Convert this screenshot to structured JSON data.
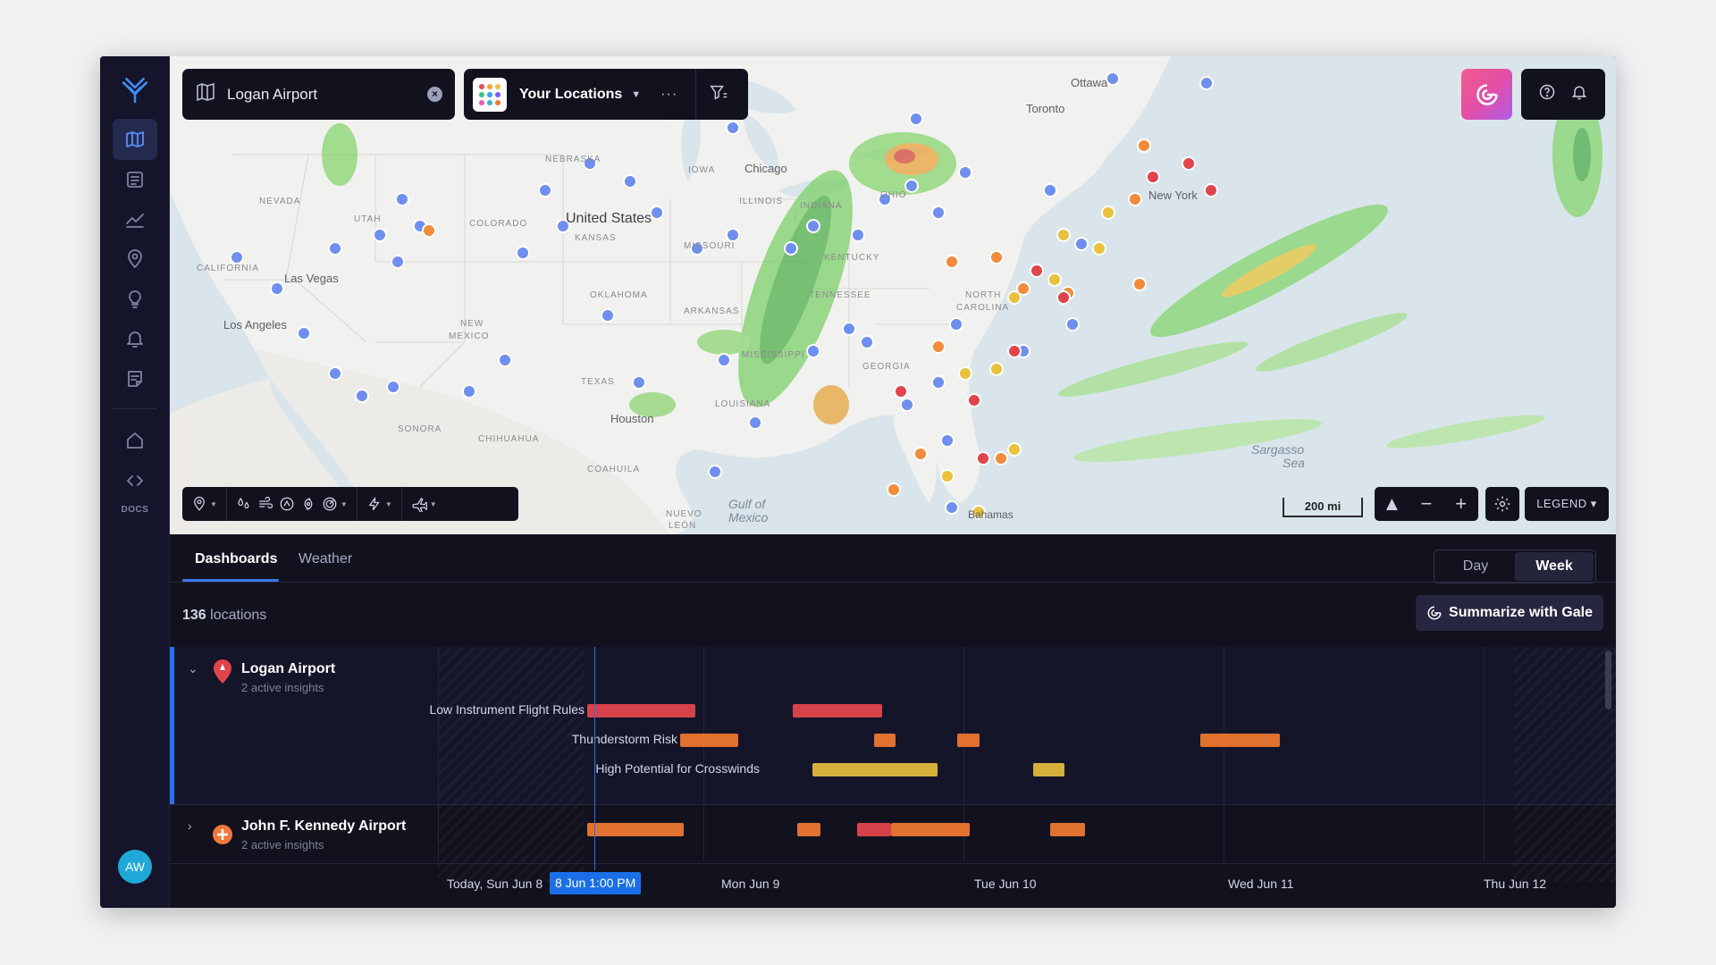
{
  "search": {
    "value": "Logan Airport"
  },
  "locations_menu": {
    "label": "Your Locations"
  },
  "map": {
    "labels": [
      {
        "text": "Ottawa",
        "name": "city-ottawa"
      },
      {
        "text": "Toronto",
        "name": "city-toronto"
      },
      {
        "text": "Chicago",
        "name": "city-chicago"
      },
      {
        "text": "New York",
        "name": "city-new-york"
      },
      {
        "text": "United States",
        "name": "country-united-states"
      },
      {
        "text": "Las Vegas",
        "name": "city-las-vegas"
      },
      {
        "text": "Los Angeles",
        "name": "city-los-angeles"
      },
      {
        "text": "Houston",
        "name": "city-houston"
      },
      {
        "text": "Gulf of",
        "name": "sea-gulf-of"
      },
      {
        "text": "Mexico",
        "name": "sea-mexico"
      },
      {
        "text": "Bahamas",
        "name": "country-bahamas"
      },
      {
        "text": "Sargasso",
        "name": "sea-sargasso"
      },
      {
        "text": "Sea",
        "name": "sea-sea"
      },
      {
        "text": "NEVADA",
        "name": "state-nevada"
      },
      {
        "text": "UTAH",
        "name": "state-utah"
      },
      {
        "text": "CALIFORNIA",
        "name": "state-california"
      },
      {
        "text": "NEBRASKA",
        "name": "state-nebraska"
      },
      {
        "text": "KANSAS",
        "name": "state-kansas"
      },
      {
        "text": "OKLAHOMA",
        "name": "state-oklahoma"
      },
      {
        "text": "TEXAS",
        "name": "state-texas"
      },
      {
        "text": "NEW",
        "name": "state-new"
      },
      {
        "text": "MEXICO",
        "name": "state-mexico"
      },
      {
        "text": "ARKANSAS",
        "name": "state-arkansas"
      },
      {
        "text": "MISSOURI",
        "name": "state-missouri"
      },
      {
        "text": "ILLINOIS",
        "name": "state-illinois"
      },
      {
        "text": "INDIANA",
        "name": "state-indiana"
      },
      {
        "text": "OHIO",
        "name": "state-ohio"
      },
      {
        "text": "KENTUCKY",
        "name": "state-kentucky"
      },
      {
        "text": "TENNESSEE",
        "name": "state-tennessee"
      },
      {
        "text": "MISSISSIPPI",
        "name": "state-mississippi"
      },
      {
        "text": "LOUISIANA",
        "name": "state-louisiana"
      },
      {
        "text": "GEORGIA",
        "name": "state-georgia"
      },
      {
        "text": "NORTH",
        "name": "state-north"
      },
      {
        "text": "CAROLINA",
        "name": "state-carolina"
      },
      {
        "text": "IOWA",
        "name": "state-iowa"
      },
      {
        "text": "SONORA",
        "name": "region-sonora"
      },
      {
        "text": "CHIHUAHUA",
        "name": "region-chihuahua"
      },
      {
        "text": "COAHUILA",
        "name": "region-coahuila"
      },
      {
        "text": "NUEVO",
        "name": "region-nuevo"
      },
      {
        "text": "LEÓN",
        "name": "region-leon"
      },
      {
        "text": "COLORADO",
        "name": "state-colorado"
      }
    ],
    "scale": "200 mi",
    "legend": "LEGEND ▾"
  },
  "tabs": [
    {
      "label": "Dashboards"
    },
    {
      "label": "Weather"
    }
  ],
  "range": {
    "day": "Day",
    "week": "Week"
  },
  "summary": {
    "count": "136",
    "unit": "locations"
  },
  "summarize_button": "Summarize with Gale",
  "rows": [
    {
      "name": "Logan Airport",
      "sub": "2 active insights",
      "insights": [
        {
          "label": "Low Instrument Flight Rules",
          "color": "#d6424a"
        },
        {
          "label": "Thunderstorm Risk",
          "color": "#e0712f"
        },
        {
          "label": "High Potential for Crosswinds",
          "color": "#d4b13a"
        }
      ]
    },
    {
      "name": "John F. Kennedy Airport",
      "sub": "2 active insights"
    }
  ],
  "timeline": {
    "today": "Today, Sun Jun 8",
    "now": "8 Jun 1:00 PM",
    "days": [
      "Mon Jun 9",
      "Tue Jun 10",
      "Wed Jun 11",
      "Thu Jun 12"
    ]
  },
  "user": {
    "initials": "AW"
  },
  "nav": {
    "docs": "DOCS"
  },
  "colors": {
    "accent": "#2d6ff2",
    "lifr": "#d6424a",
    "thunder": "#e0712f",
    "crosswind": "#d4b13a"
  }
}
